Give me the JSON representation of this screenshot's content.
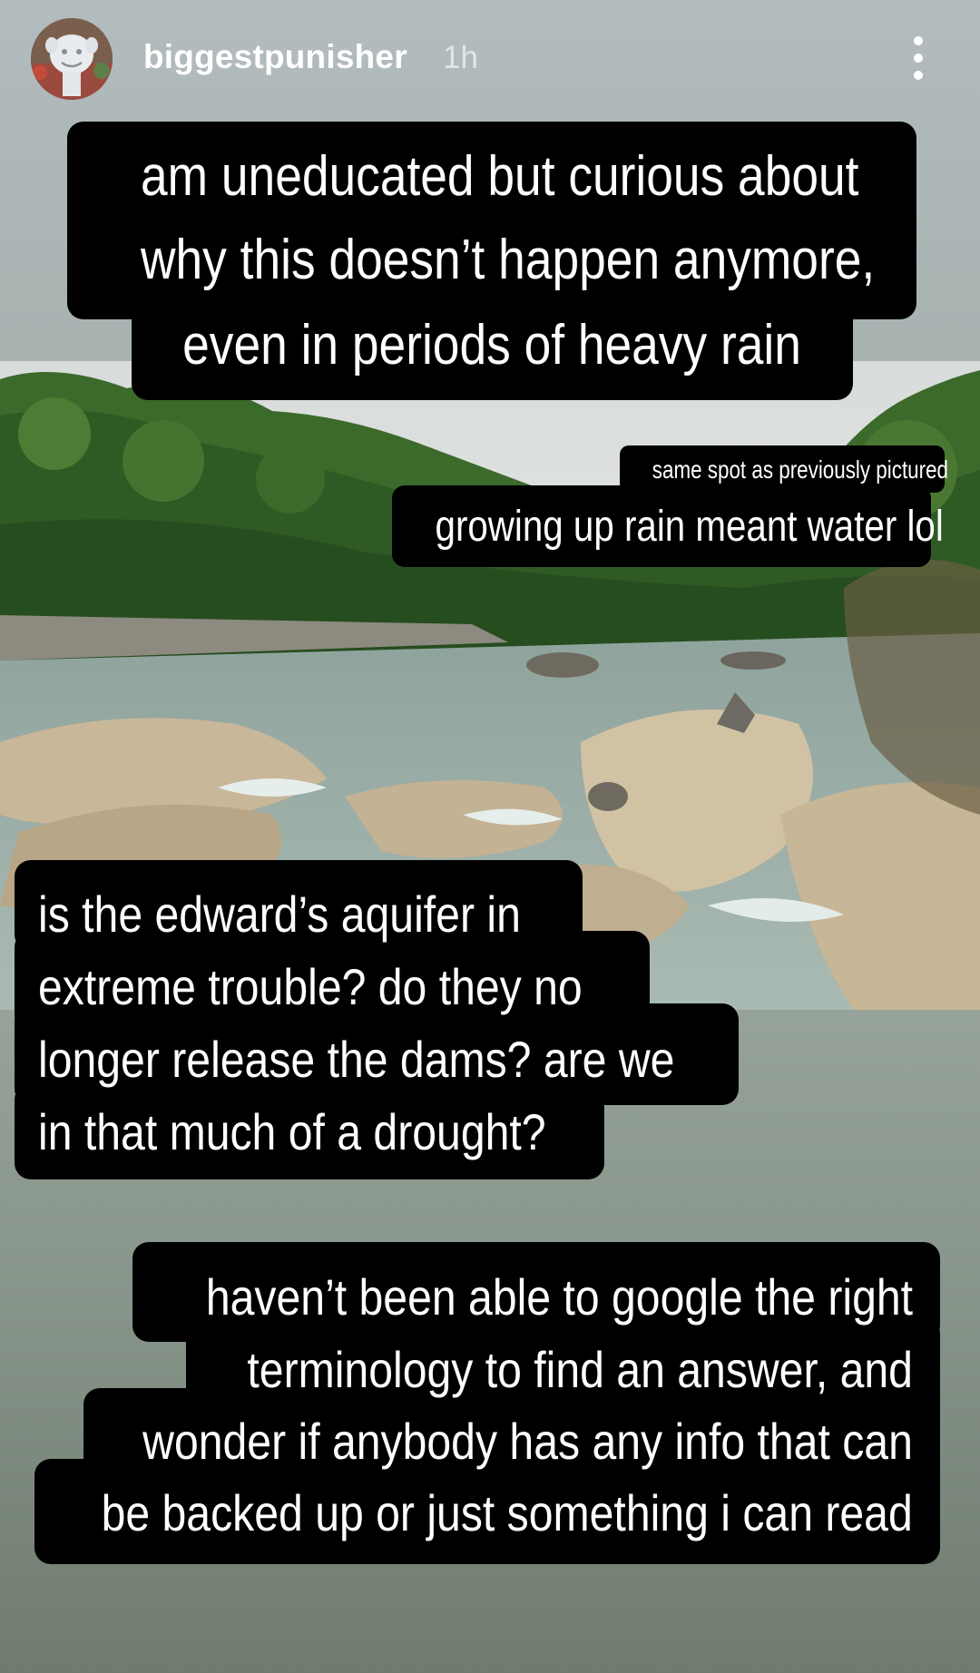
{
  "story": {
    "username": "biggestpunisher",
    "time_ago": "1h",
    "avatar_icon": "avatar-statue-face",
    "more_icon": "more-vertical-icon"
  },
  "captions": {
    "question_1": [
      "am uneducated but curious about",
      "why this doesn’t happen anymore,",
      "even in periods of heavy rain"
    ],
    "photo_note_small": "same spot as previously pictured",
    "photo_note_big": "growing up rain meant water lol",
    "question_2": [
      "is the edward’s aquifer in",
      "extreme trouble? do they no",
      "longer release the dams? are we",
      "in that much of a drought?"
    ],
    "question_3": [
      "haven’t been able to google the right",
      "terminology to find an answer, and",
      "wonder if anybody has any info that can",
      "be backed up or just something i can read"
    ]
  },
  "colors": {
    "caption_bg": "#000000",
    "caption_text": "#ffffff"
  }
}
